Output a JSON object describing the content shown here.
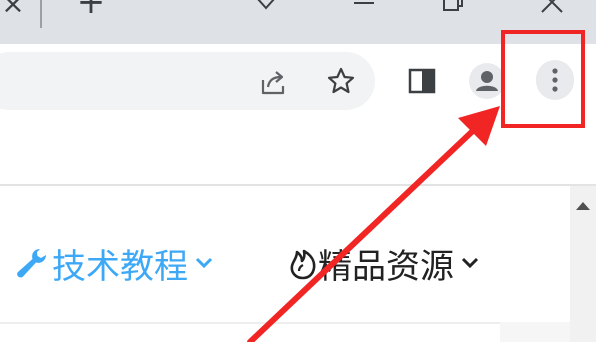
{
  "window": {
    "tab_close_glyph": "×",
    "new_tab_glyph": "+"
  },
  "toolbar": {
    "icons": [
      "share-icon",
      "star-icon",
      "side-panel-icon",
      "profile-avatar-icon",
      "more-menu-icon"
    ]
  },
  "nav": {
    "items": [
      {
        "label": "技术教程",
        "icon": "wrench-icon",
        "color": "#3da8f5"
      },
      {
        "label": "精品资源",
        "icon": "flame-icon",
        "color": "#222222"
      }
    ]
  },
  "annotation": {
    "color": "#f22525",
    "target": "more-menu-button"
  },
  "colors": {
    "titlebar": "#dee1e6",
    "omnibox": "#f1f3f4",
    "menu_button_bg": "#e8eaed"
  }
}
